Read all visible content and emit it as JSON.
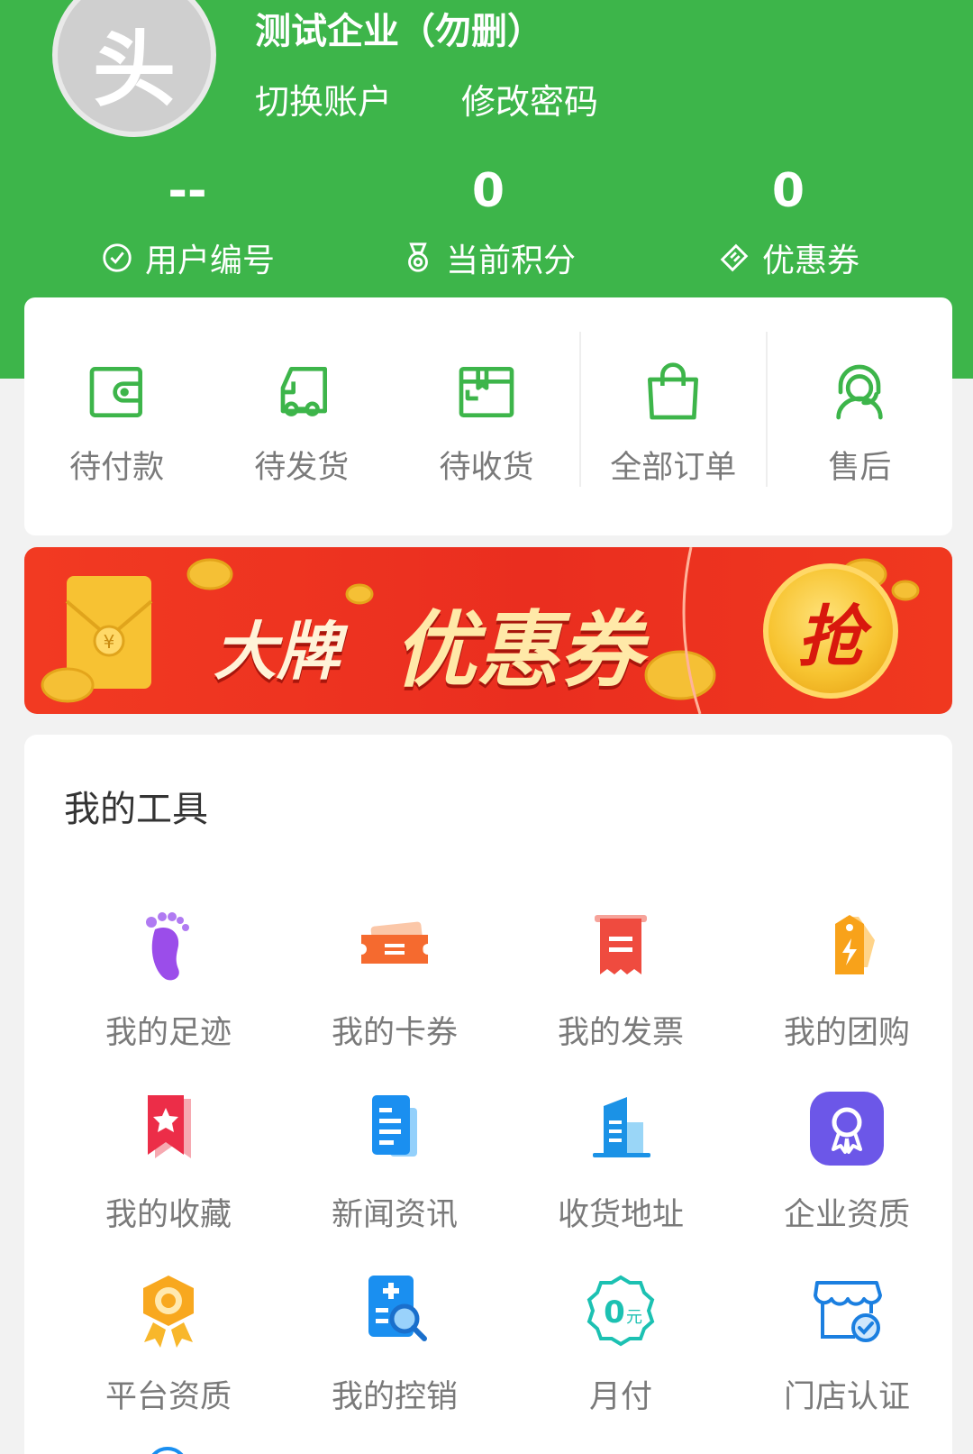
{
  "colors": {
    "brand_green": "#3db54a",
    "icon_green": "#3db54a",
    "banner_red": "#ea2e1f"
  },
  "header": {
    "avatar_char": "头",
    "company_name": "测试企业（勿删）",
    "switch_account": "切换账户",
    "change_password": "修改密码"
  },
  "stats": [
    {
      "value": "--",
      "label": "用户编号",
      "icon": "clock-check-icon"
    },
    {
      "value": "0",
      "label": "当前积分",
      "icon": "medal-icon"
    },
    {
      "value": "0",
      "label": "优惠券",
      "icon": "ticket-icon"
    }
  ],
  "orders": [
    {
      "label": "待付款",
      "icon": "wallet-icon"
    },
    {
      "label": "待发货",
      "icon": "truck-icon"
    },
    {
      "label": "待收货",
      "icon": "package-icon"
    },
    {
      "label": "全部订单",
      "icon": "shopping-bag-icon"
    },
    {
      "label": "售后",
      "icon": "customer-service-icon"
    }
  ],
  "banner": {
    "text_small": "大牌",
    "text_big": "优惠券",
    "grab": "抢"
  },
  "tools": {
    "title": "我的工具",
    "items": [
      {
        "label": "我的足迹",
        "icon": "footprint-icon"
      },
      {
        "label": "我的卡券",
        "icon": "card-coupon-icon"
      },
      {
        "label": "我的发票",
        "icon": "invoice-icon"
      },
      {
        "label": "我的团购",
        "icon": "group-buy-tag-icon"
      },
      {
        "label": "我的收藏",
        "icon": "bookmark-star-icon"
      },
      {
        "label": "新闻资讯",
        "icon": "news-document-icon"
      },
      {
        "label": "收货地址",
        "icon": "building-icon"
      },
      {
        "label": "企业资质",
        "icon": "award-badge-icon"
      },
      {
        "label": "平台资质",
        "icon": "gold-medal-icon"
      },
      {
        "label": "我的控销",
        "icon": "search-document-icon"
      },
      {
        "label": "月付",
        "icon": "zero-yuan-icon"
      },
      {
        "label": "门店认证",
        "icon": "store-verified-icon"
      }
    ]
  }
}
